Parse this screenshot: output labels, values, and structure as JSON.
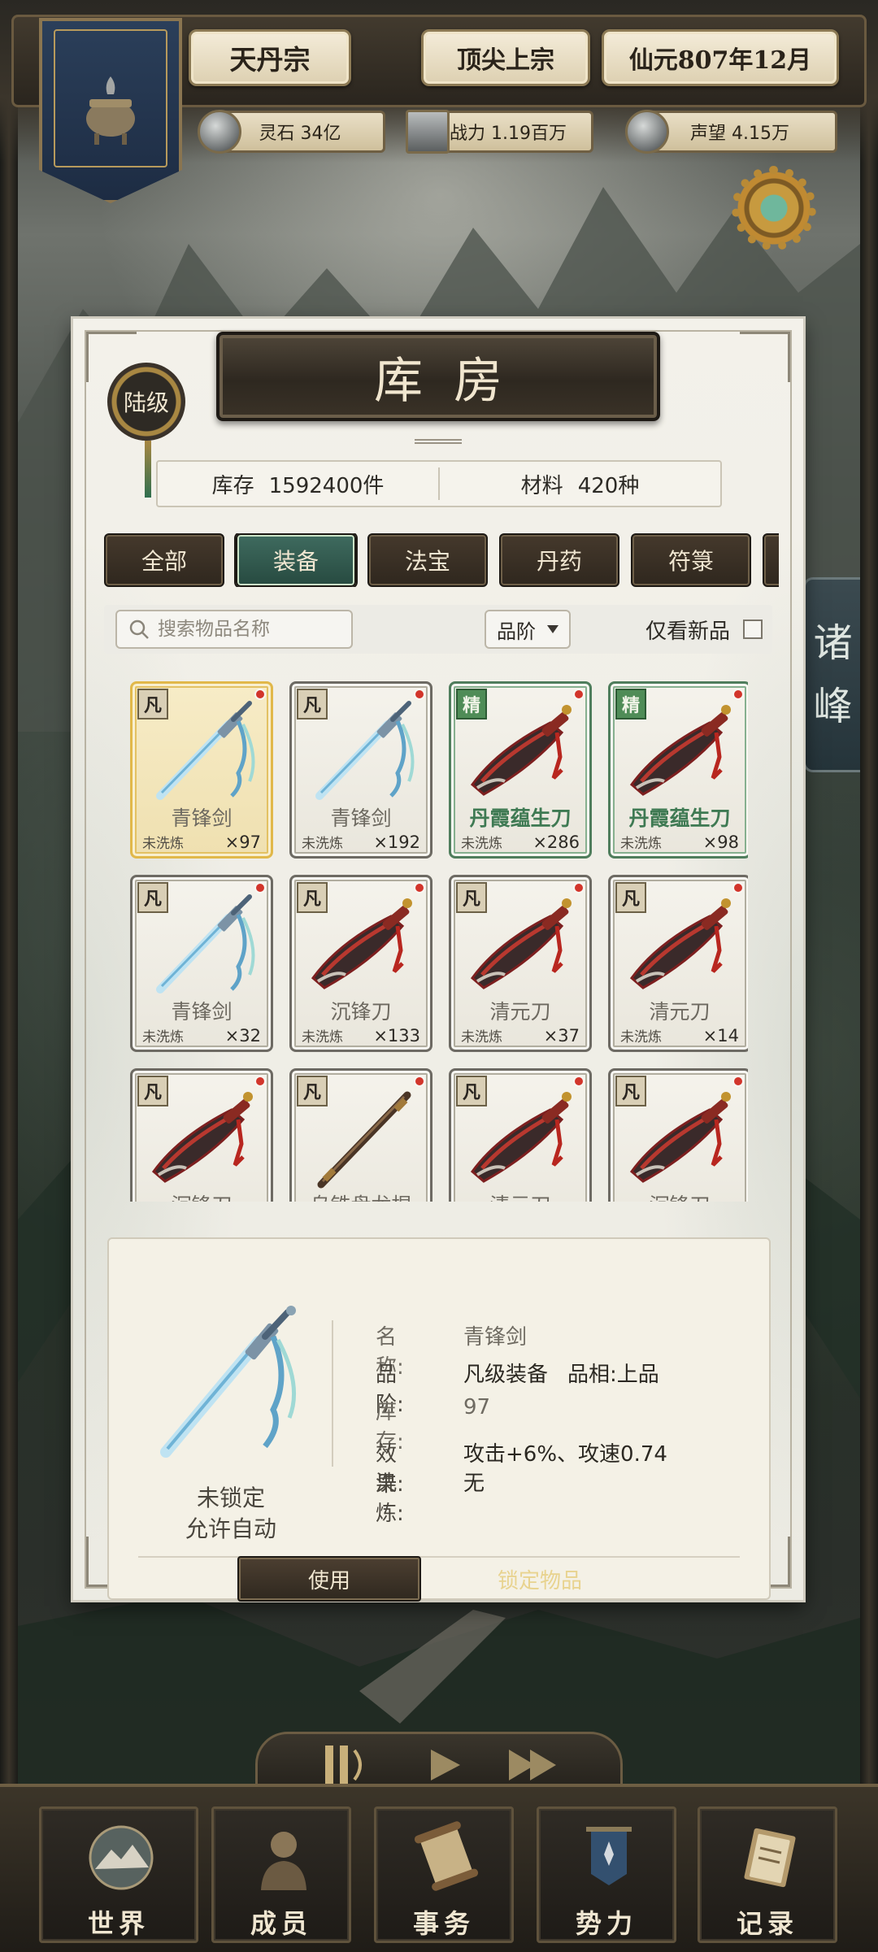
{
  "header": {
    "sect_name": "天丹宗",
    "sect_rank": "顶尖上宗",
    "date": "仙元807年12月",
    "stats": [
      {
        "icon": "spirit-stone-icon",
        "label": "灵石 34亿"
      },
      {
        "icon": "sword-power-icon",
        "label": "战力 1.19百万"
      },
      {
        "icon": "prestige-icon",
        "label": "声望 4.15万"
      }
    ]
  },
  "side_tab": {
    "chars": [
      "诸",
      "峰"
    ]
  },
  "panel": {
    "title": "库房",
    "rank_badge": "陆级",
    "inventory": {
      "stock_label": "库存",
      "stock_value": "1592400件",
      "material_label": "材料",
      "material_value": "420种"
    },
    "tabs": [
      {
        "label": "全部"
      },
      {
        "label": "装备",
        "active": true
      },
      {
        "label": "法宝"
      },
      {
        "label": "丹药"
      },
      {
        "label": "符箓"
      }
    ],
    "filter": {
      "search_placeholder": "搜索物品名称",
      "sort_value": "品阶",
      "new_only_label": "仅看新品"
    },
    "items": [
      {
        "grade": "凡",
        "name": "青锋剑",
        "status": "未洗炼",
        "qty": "×97",
        "art": "sword",
        "elite": false,
        "selected": true
      },
      {
        "grade": "凡",
        "name": "青锋剑",
        "status": "未洗炼",
        "qty": "×192",
        "art": "sword",
        "elite": false
      },
      {
        "grade": "精",
        "name": "丹霞蕴生刀",
        "status": "未洗炼",
        "qty": "×286",
        "art": "saber",
        "elite": true
      },
      {
        "grade": "精",
        "name": "丹霞蕴生刀",
        "status": "未洗炼",
        "qty": "×98",
        "art": "saber",
        "elite": true
      },
      {
        "grade": "凡",
        "name": "青锋剑",
        "status": "未洗炼",
        "qty": "×32",
        "art": "sword",
        "elite": false
      },
      {
        "grade": "凡",
        "name": "沉锋刀",
        "status": "未洗炼",
        "qty": "×133",
        "art": "saber",
        "elite": false
      },
      {
        "grade": "凡",
        "name": "清元刀",
        "status": "未洗炼",
        "qty": "×37",
        "art": "saber",
        "elite": false
      },
      {
        "grade": "凡",
        "name": "清元刀",
        "status": "未洗炼",
        "qty": "×14",
        "art": "saber",
        "elite": false
      },
      {
        "grade": "凡",
        "name": "沉锋刀",
        "status": "",
        "qty": "",
        "art": "saber",
        "elite": false
      },
      {
        "grade": "凡",
        "name": "乌铁盘龙棍",
        "status": "",
        "qty": "",
        "art": "staff",
        "elite": false
      },
      {
        "grade": "凡",
        "name": "清元刀",
        "status": "",
        "qty": "",
        "art": "saber",
        "elite": false
      },
      {
        "grade": "凡",
        "name": "沉锋刀",
        "status": "",
        "qty": "",
        "art": "saber",
        "elite": false
      }
    ],
    "detail": {
      "lock_line1": "未锁定",
      "lock_line2": "允许自动",
      "name_key": "名称:",
      "name_value": "青锋剑",
      "grade_key": "品阶:",
      "grade_value": "凡级装备",
      "quality": "品相:上品",
      "stock_key": "库存:",
      "stock_value": "97",
      "effect_key": "效果:",
      "effect_value": "攻击+6%、攻速0.74",
      "refine_key": "洗炼:",
      "refine_value": "无",
      "use_button": "使用",
      "lock_button": "锁定物品"
    }
  },
  "bottom_nav": [
    {
      "label": "世界",
      "icon": "world-icon"
    },
    {
      "label": "成员",
      "icon": "member-icon"
    },
    {
      "label": "事务",
      "icon": "scroll-icon"
    },
    {
      "label": "势力",
      "icon": "faction-banner-icon"
    },
    {
      "label": "记录",
      "icon": "book-icon"
    }
  ],
  "colors": {
    "accent_green": "#3f6b5f",
    "elite_green": "#4f8c57",
    "selected_gold": "#e1b84a",
    "new_dot": "#d2352b"
  }
}
